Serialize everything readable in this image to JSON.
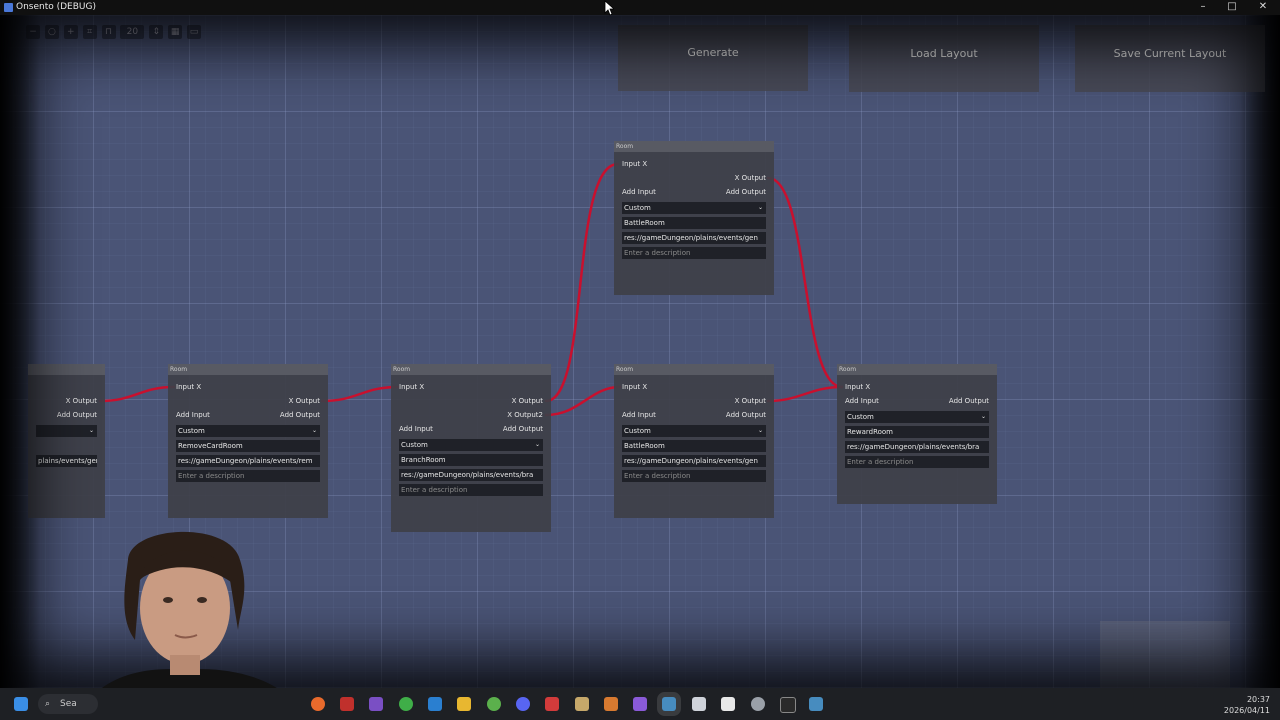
{
  "window": {
    "title": "Onsento (DEBUG)",
    "minimize": "–",
    "maximize": "□",
    "close": "✕"
  },
  "toolbar": {
    "zoom": "20"
  },
  "buttons": {
    "generate": "Generate",
    "load": "Load Layout",
    "save": "Save Current Layout"
  },
  "nodes": [
    {
      "head": "",
      "output": "X  Output",
      "add_output": "Add Output",
      "path": "plains/events/gen"
    },
    {
      "head": "Room",
      "input": "Input  X",
      "output": "X  Output",
      "add_input": "Add Input",
      "add_output": "Add Output",
      "mode": "Custom",
      "name": "RemoveCardRoom",
      "path": "res://gameDungeon/plains/events/rem",
      "desc": "Enter a description"
    },
    {
      "head": "Room",
      "input": "Input  X",
      "output": "X  Output",
      "output2": "X  Output2",
      "add_input": "Add Input",
      "add_output": "Add Output",
      "mode": "Custom",
      "name": "BranchRoom",
      "path": "res://gameDungeon/plains/events/bra",
      "desc": "Enter a description"
    },
    {
      "head": "Room",
      "input": "Input  X",
      "output": "X  Output",
      "add_input": "Add Input",
      "add_output": "Add Output",
      "mode": "Custom",
      "name": "BattleRoom",
      "path": "res://gameDungeon/plains/events/gen",
      "desc": "Enter a description"
    },
    {
      "head": "Room",
      "input": "Input  X",
      "output": "X  Output",
      "add_input": "Add Input",
      "add_output": "Add Output",
      "mode": "Custom",
      "name": "BattleRoom",
      "path": "res://gameDungeon/plains/events/gen",
      "desc": "Enter a description"
    },
    {
      "head": "Room",
      "input": "Input  X",
      "add_input": "Add Input",
      "add_output": "Add Output",
      "mode": "Custom",
      "name": "RewardRoom",
      "path": "res://gameDungeon/plains/events/bra",
      "desc": "Enter a description"
    }
  ],
  "taskbar": {
    "search": "Sea",
    "time": "20:37",
    "date": "2026/04/11"
  },
  "colors": {
    "wire": "#c8102e",
    "canvas": "#4a5476",
    "node": "#3e4048"
  }
}
